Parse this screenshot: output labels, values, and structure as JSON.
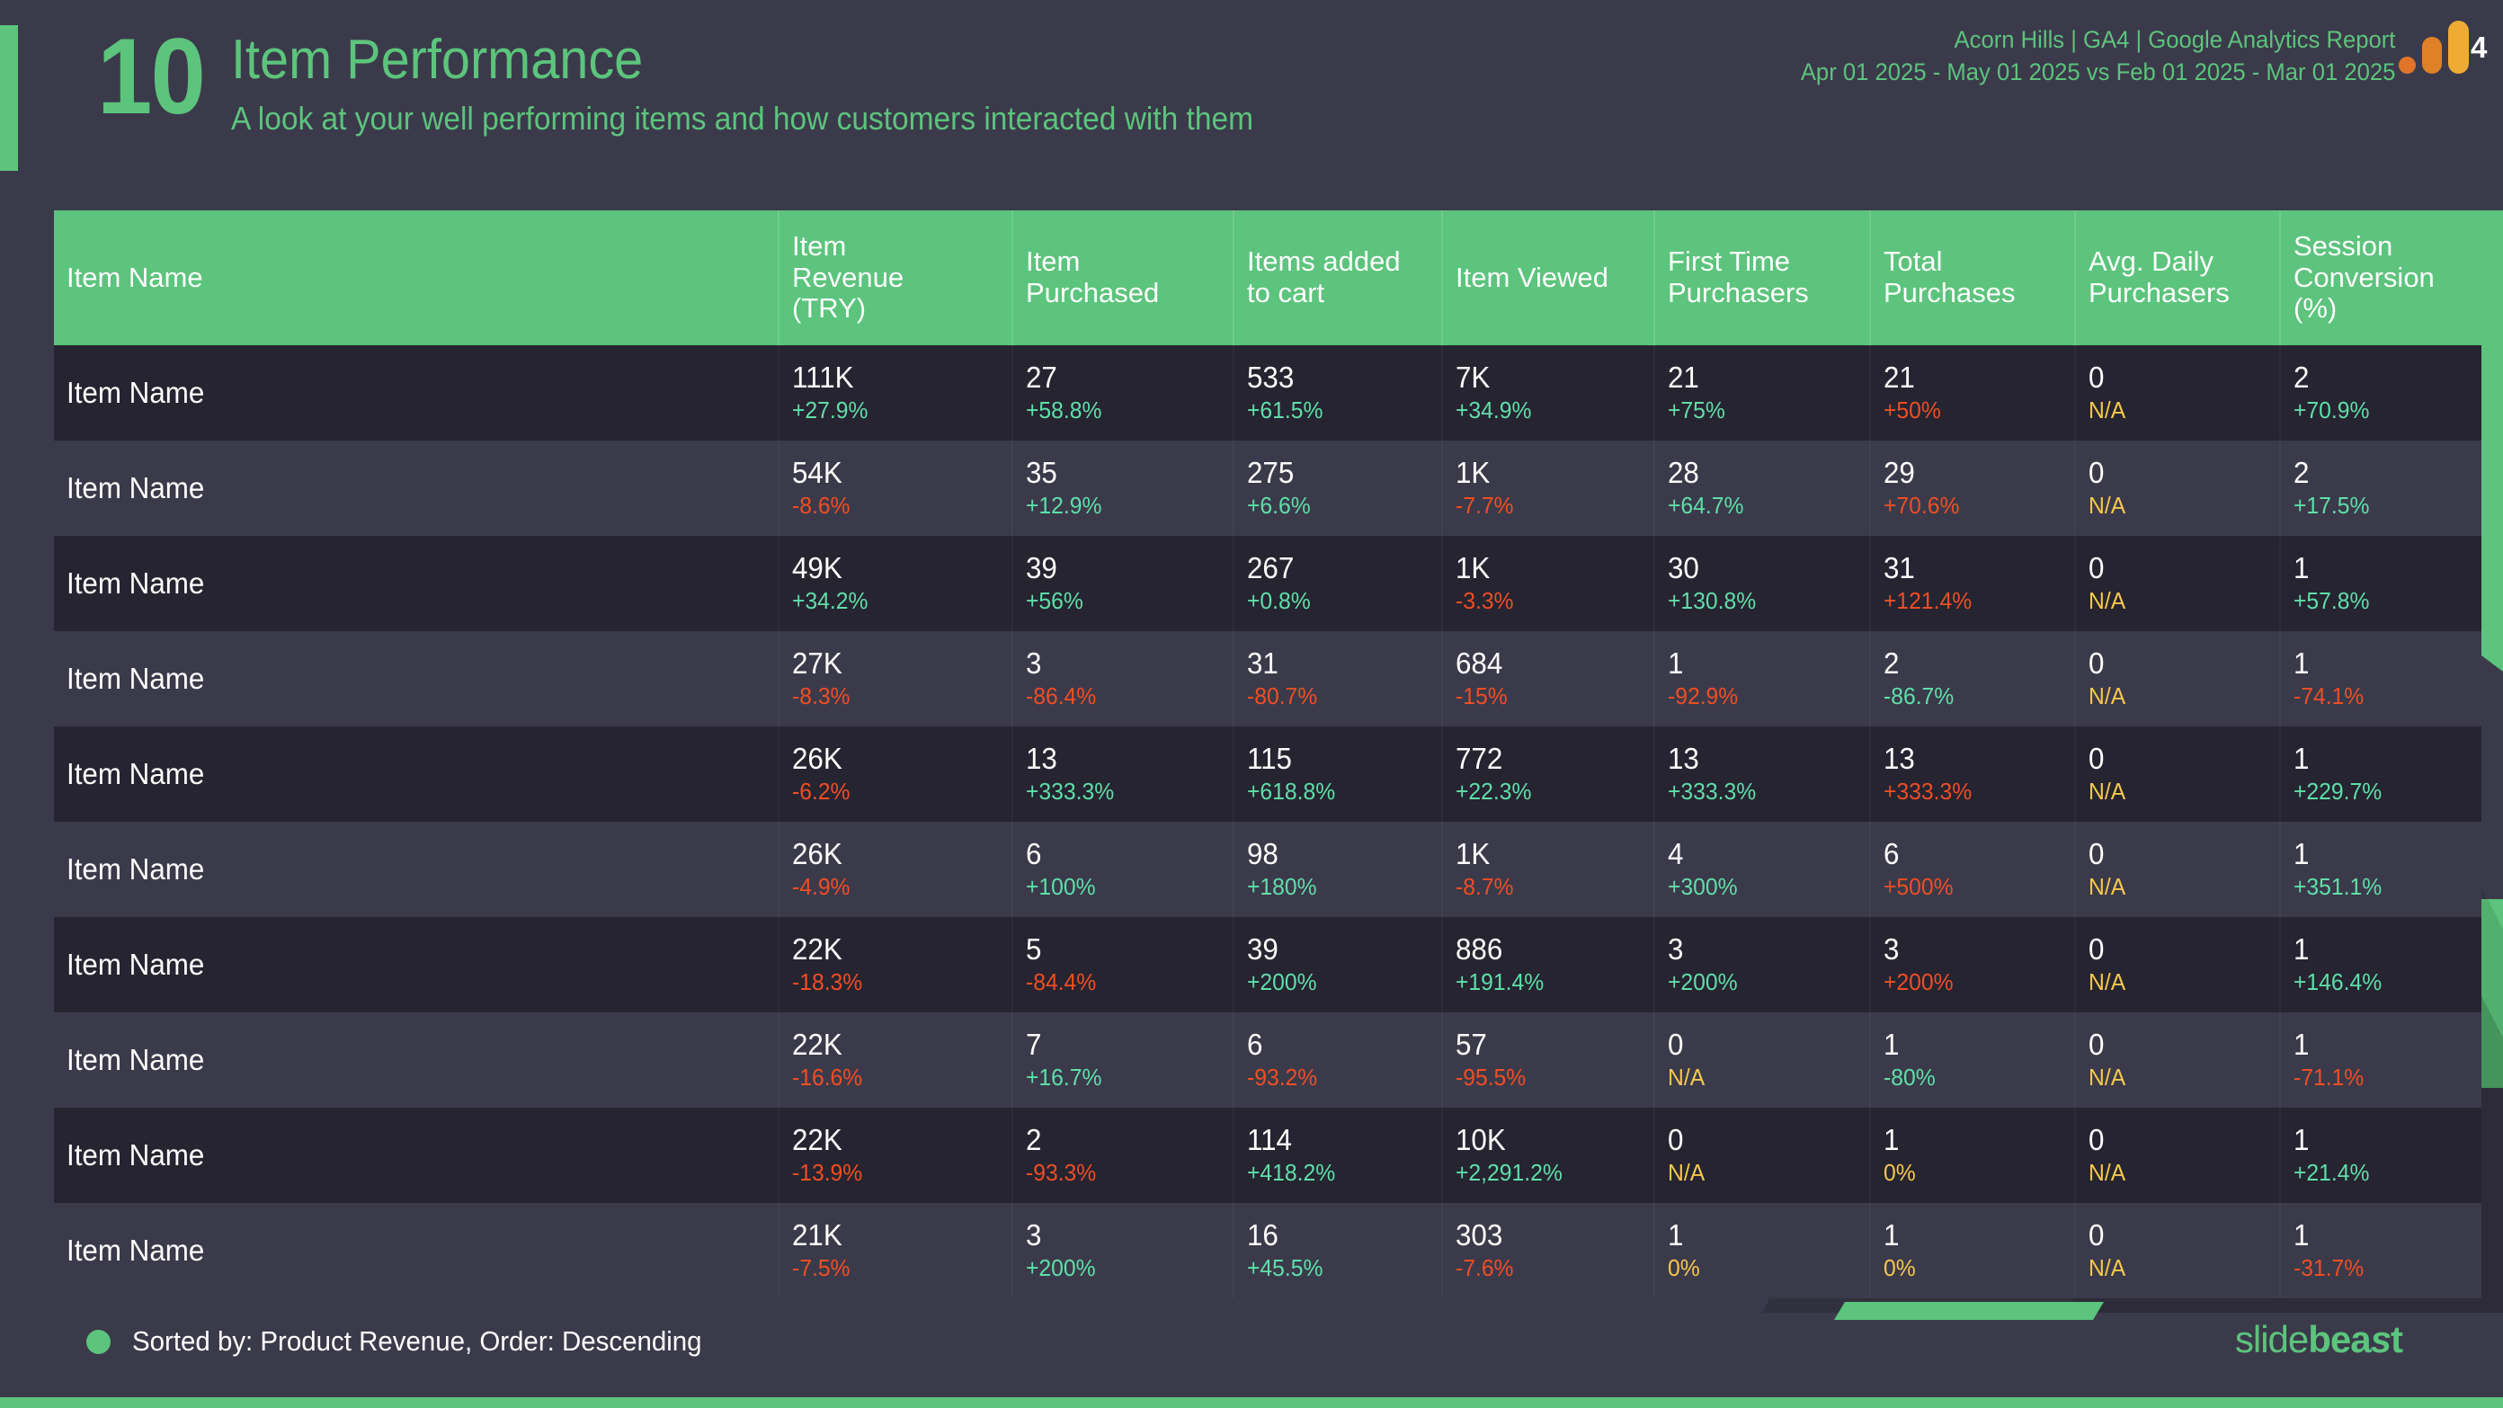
{
  "slide": {
    "number": "10",
    "title": "Item Performance",
    "subtitle": "A look at your well performing items and how customers interacted with them",
    "meta_line1": "Acorn Hills | GA4 | Google Analytics Report",
    "meta_line2": "Apr 01 2025 - May 01 2025 vs Feb 01 2025 - Mar 01 2025",
    "ga4_badge": "4"
  },
  "colors": {
    "background": "#3b3a4b",
    "accent_green": "#5cc47c",
    "row_dark": "#262431",
    "row_light": "#3b3a4b",
    "delta_positive": "#5fdfa9",
    "delta_negative": "#ef4e23",
    "delta_na": "#f5c84c",
    "ga4_orange_small": "#e0742a",
    "ga4_orange_mid": "#e08128",
    "ga4_orange_tall": "#f0ab33"
  },
  "table": {
    "columns": [
      "Item Name",
      "Item Revenue (TRY)",
      "Item Purchased",
      "Items added to cart",
      "Item Viewed",
      "First Time Purchasers",
      "Total Purchases",
      "Avg. Daily Purchasers",
      "Session Conversion (%)"
    ],
    "column_lines": [
      [
        "Item Name"
      ],
      [
        "Item",
        "Revenue",
        "(TRY)"
      ],
      [
        "Item",
        "Purchased"
      ],
      [
        "Items added",
        "to cart"
      ],
      [
        "Item Viewed"
      ],
      [
        "First Time",
        "Purchasers"
      ],
      [
        "Total",
        "Purchases"
      ],
      [
        "Avg. Daily",
        "Purchasers"
      ],
      [
        "Session",
        "Conversion",
        "(%)"
      ]
    ],
    "rows": [
      {
        "name": "Item Name",
        "cells": [
          {
            "value": "111K",
            "delta": "+27.9%",
            "tone": "pos"
          },
          {
            "value": "27",
            "delta": "+58.8%",
            "tone": "pos"
          },
          {
            "value": "533",
            "delta": "+61.5%",
            "tone": "pos"
          },
          {
            "value": "7K",
            "delta": "+34.9%",
            "tone": "pos"
          },
          {
            "value": "21",
            "delta": "+75%",
            "tone": "pos"
          },
          {
            "value": "21",
            "delta": "+50%",
            "tone": "neg"
          },
          {
            "value": "0",
            "delta": "N/A",
            "tone": "na"
          },
          {
            "value": "2",
            "delta": "+70.9%",
            "tone": "pos"
          }
        ]
      },
      {
        "name": "Item Name",
        "cells": [
          {
            "value": "54K",
            "delta": "-8.6%",
            "tone": "neg"
          },
          {
            "value": "35",
            "delta": "+12.9%",
            "tone": "pos"
          },
          {
            "value": "275",
            "delta": "+6.6%",
            "tone": "pos"
          },
          {
            "value": "1K",
            "delta": "-7.7%",
            "tone": "neg"
          },
          {
            "value": "28",
            "delta": "+64.7%",
            "tone": "pos"
          },
          {
            "value": "29",
            "delta": "+70.6%",
            "tone": "neg"
          },
          {
            "value": "0",
            "delta": "N/A",
            "tone": "na"
          },
          {
            "value": "2",
            "delta": "+17.5%",
            "tone": "pos"
          }
        ]
      },
      {
        "name": "Item Name",
        "cells": [
          {
            "value": "49K",
            "delta": "+34.2%",
            "tone": "pos"
          },
          {
            "value": "39",
            "delta": "+56%",
            "tone": "pos"
          },
          {
            "value": "267",
            "delta": "+0.8%",
            "tone": "pos"
          },
          {
            "value": "1K",
            "delta": "-3.3%",
            "tone": "neg"
          },
          {
            "value": "30",
            "delta": "+130.8%",
            "tone": "pos"
          },
          {
            "value": "31",
            "delta": "+121.4%",
            "tone": "neg"
          },
          {
            "value": "0",
            "delta": "N/A",
            "tone": "na"
          },
          {
            "value": "1",
            "delta": "+57.8%",
            "tone": "pos"
          }
        ]
      },
      {
        "name": "Item Name",
        "cells": [
          {
            "value": "27K",
            "delta": "-8.3%",
            "tone": "neg"
          },
          {
            "value": "3",
            "delta": "-86.4%",
            "tone": "neg"
          },
          {
            "value": "31",
            "delta": "-80.7%",
            "tone": "neg"
          },
          {
            "value": "684",
            "delta": "-15%",
            "tone": "neg"
          },
          {
            "value": "1",
            "delta": "-92.9%",
            "tone": "neg"
          },
          {
            "value": "2",
            "delta": "-86.7%",
            "tone": "pos"
          },
          {
            "value": "0",
            "delta": "N/A",
            "tone": "na"
          },
          {
            "value": "1",
            "delta": "-74.1%",
            "tone": "neg"
          }
        ]
      },
      {
        "name": "Item Name",
        "cells": [
          {
            "value": "26K",
            "delta": "-6.2%",
            "tone": "neg"
          },
          {
            "value": "13",
            "delta": "+333.3%",
            "tone": "pos"
          },
          {
            "value": "115",
            "delta": "+618.8%",
            "tone": "pos"
          },
          {
            "value": "772",
            "delta": "+22.3%",
            "tone": "pos"
          },
          {
            "value": "13",
            "delta": "+333.3%",
            "tone": "pos"
          },
          {
            "value": "13",
            "delta": "+333.3%",
            "tone": "neg"
          },
          {
            "value": "0",
            "delta": "N/A",
            "tone": "na"
          },
          {
            "value": "1",
            "delta": "+229.7%",
            "tone": "pos"
          }
        ]
      },
      {
        "name": "Item Name",
        "cells": [
          {
            "value": "26K",
            "delta": "-4.9%",
            "tone": "neg"
          },
          {
            "value": "6",
            "delta": "+100%",
            "tone": "pos"
          },
          {
            "value": "98",
            "delta": "+180%",
            "tone": "pos"
          },
          {
            "value": "1K",
            "delta": "-8.7%",
            "tone": "neg"
          },
          {
            "value": "4",
            "delta": "+300%",
            "tone": "pos"
          },
          {
            "value": "6",
            "delta": "+500%",
            "tone": "neg"
          },
          {
            "value": "0",
            "delta": "N/A",
            "tone": "na"
          },
          {
            "value": "1",
            "delta": "+351.1%",
            "tone": "pos"
          }
        ]
      },
      {
        "name": "Item Name",
        "cells": [
          {
            "value": "22K",
            "delta": "-18.3%",
            "tone": "neg"
          },
          {
            "value": "5",
            "delta": "-84.4%",
            "tone": "neg"
          },
          {
            "value": "39",
            "delta": "+200%",
            "tone": "pos"
          },
          {
            "value": "886",
            "delta": "+191.4%",
            "tone": "pos"
          },
          {
            "value": "3",
            "delta": "+200%",
            "tone": "pos"
          },
          {
            "value": "3",
            "delta": "+200%",
            "tone": "neg"
          },
          {
            "value": "0",
            "delta": "N/A",
            "tone": "na"
          },
          {
            "value": "1",
            "delta": "+146.4%",
            "tone": "pos"
          }
        ]
      },
      {
        "name": "Item Name",
        "cells": [
          {
            "value": "22K",
            "delta": "-16.6%",
            "tone": "neg"
          },
          {
            "value": "7",
            "delta": "+16.7%",
            "tone": "pos"
          },
          {
            "value": "6",
            "delta": "-93.2%",
            "tone": "neg"
          },
          {
            "value": "57",
            "delta": "-95.5%",
            "tone": "neg"
          },
          {
            "value": "0",
            "delta": "N/A",
            "tone": "na"
          },
          {
            "value": "1",
            "delta": "-80%",
            "tone": "pos"
          },
          {
            "value": "0",
            "delta": "N/A",
            "tone": "na"
          },
          {
            "value": "1",
            "delta": "-71.1%",
            "tone": "neg"
          }
        ]
      },
      {
        "name": "Item Name",
        "cells": [
          {
            "value": "22K",
            "delta": "-13.9%",
            "tone": "neg"
          },
          {
            "value": "2",
            "delta": "-93.3%",
            "tone": "neg"
          },
          {
            "value": "114",
            "delta": "+418.2%",
            "tone": "pos"
          },
          {
            "value": "10K",
            "delta": "+2,291.2%",
            "tone": "pos"
          },
          {
            "value": "0",
            "delta": "N/A",
            "tone": "na"
          },
          {
            "value": "1",
            "delta": "0%",
            "tone": "na"
          },
          {
            "value": "0",
            "delta": "N/A",
            "tone": "na"
          },
          {
            "value": "1",
            "delta": "+21.4%",
            "tone": "pos"
          }
        ]
      },
      {
        "name": "Item Name",
        "cells": [
          {
            "value": "21K",
            "delta": "-7.5%",
            "tone": "neg"
          },
          {
            "value": "3",
            "delta": "+200%",
            "tone": "pos"
          },
          {
            "value": "16",
            "delta": "+45.5%",
            "tone": "pos"
          },
          {
            "value": "303",
            "delta": "-7.6%",
            "tone": "neg"
          },
          {
            "value": "1",
            "delta": "0%",
            "tone": "na"
          },
          {
            "value": "1",
            "delta": "0%",
            "tone": "na"
          },
          {
            "value": "0",
            "delta": "N/A",
            "tone": "na"
          },
          {
            "value": "1",
            "delta": "-31.7%",
            "tone": "neg"
          }
        ]
      }
    ]
  },
  "footer": {
    "note": "Sorted by: Product Revenue, Order: Descending",
    "brand_part1": "slide",
    "brand_part2": "bea",
    "brand_part3": "s",
    "brand_part4": "t"
  }
}
